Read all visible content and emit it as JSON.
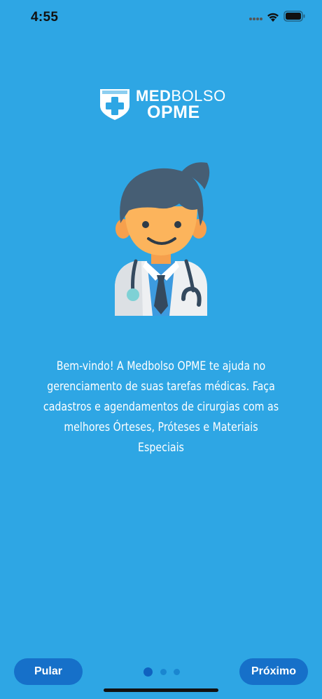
{
  "status": {
    "time": "4:55"
  },
  "logo": {
    "word1_bold": "MED",
    "word1_rest": "BOLSO",
    "word2": "OPME"
  },
  "intro": {
    "text": "Bem-vindo! A Medbolso OPME te ajuda no gerenciamento de suas tarefas médicas. Faça cadastros e agendamentos de cirurgias com as melhores Órteses, Próteses e Materiais Especiais"
  },
  "pagination": {
    "current": 1,
    "total": 3
  },
  "buttons": {
    "skip_label": "Pular",
    "next_label": "Próximo"
  },
  "colors": {
    "background": "#2EA6E4",
    "button": "#1670C9",
    "active_dot": "#0F62C0",
    "inactive_dot": "#1A86D0"
  }
}
